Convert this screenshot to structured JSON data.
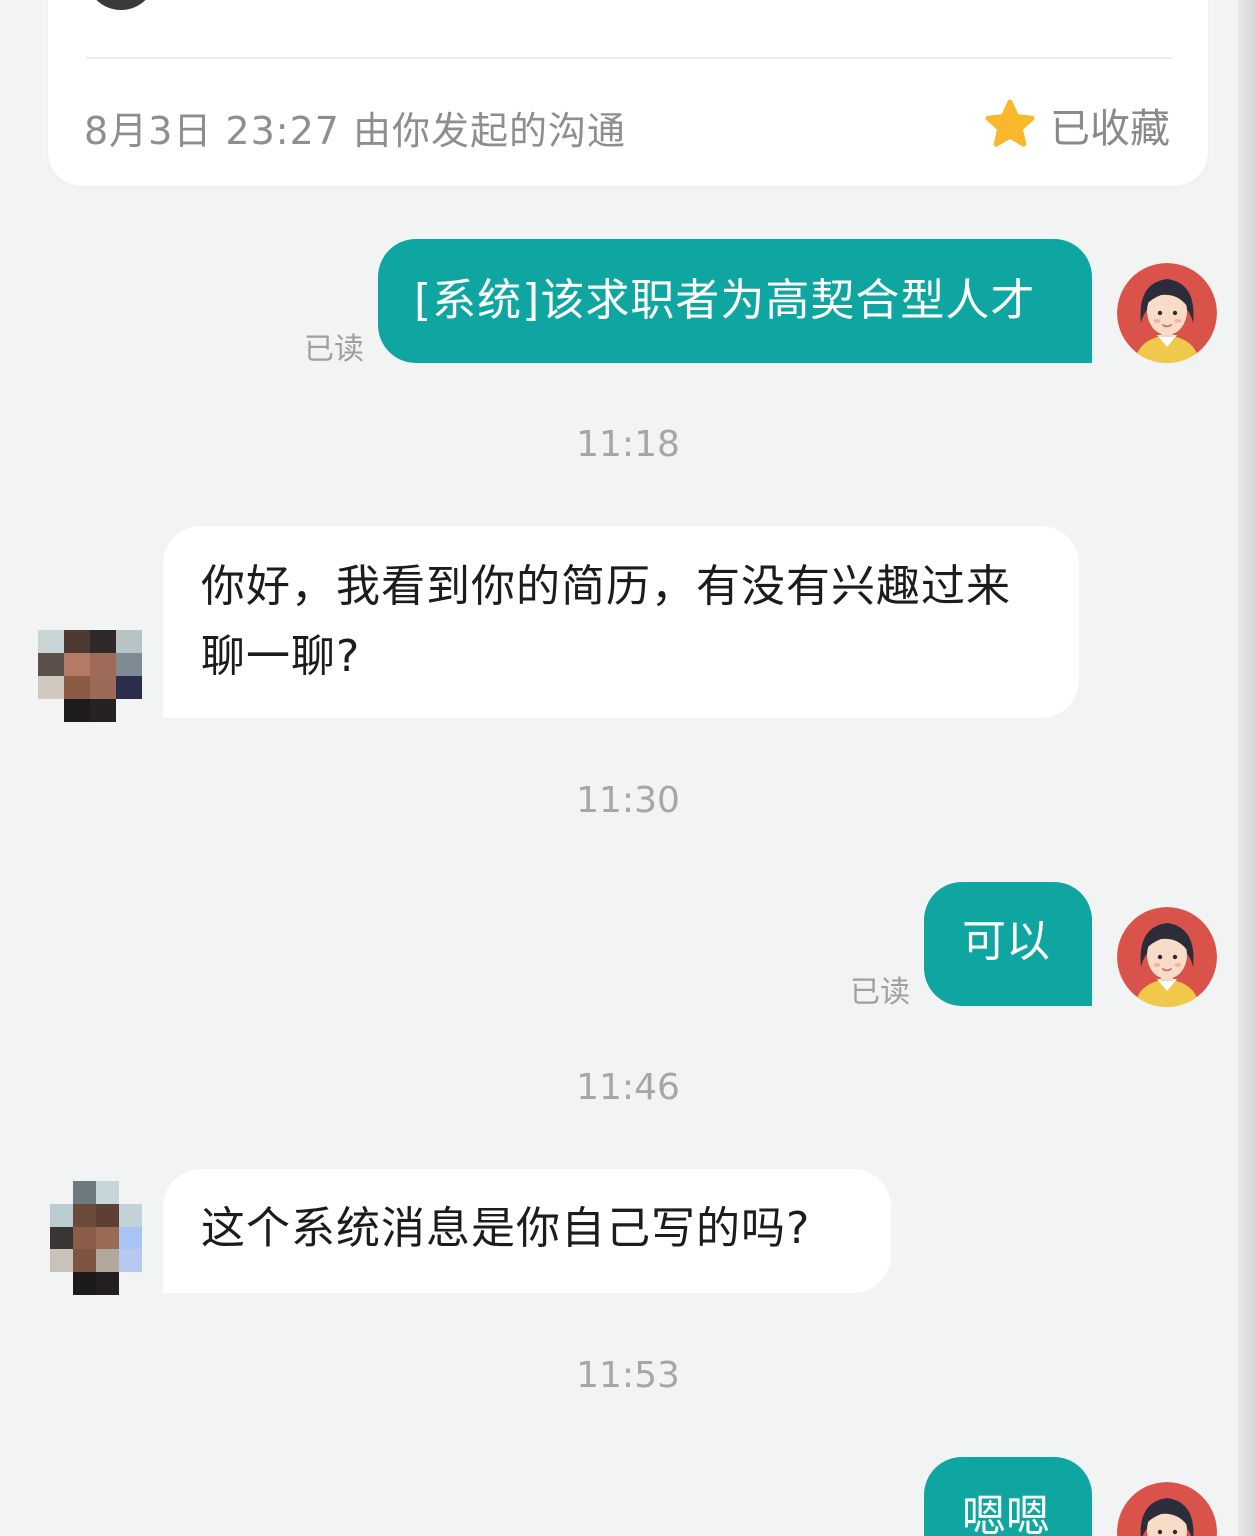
{
  "card": {
    "meta": "8月3日  23:27  由你发起的沟通",
    "favorite_label": "已收藏",
    "star_color": "#f9b82c"
  },
  "colors": {
    "outgoing_bubble": "#0fa6a1",
    "incoming_bubble": "#ffffff",
    "background": "#f2f3f3"
  },
  "messages": [
    {
      "direction": "out",
      "text": "[系统]该求职者为高契合型人才",
      "read": "已读"
    },
    {
      "direction": "in",
      "time": "11:18",
      "line1": "你好，我看到你的简历，有没有兴趣过来",
      "line2": "聊一聊?"
    },
    {
      "direction": "out",
      "time": "11:30",
      "text": "可以",
      "read": "已读"
    },
    {
      "direction": "in",
      "time": "11:46",
      "text": "这个系统消息是你自己写的吗?"
    },
    {
      "direction": "out",
      "time": "11:53",
      "text": "嗯嗯"
    }
  ]
}
